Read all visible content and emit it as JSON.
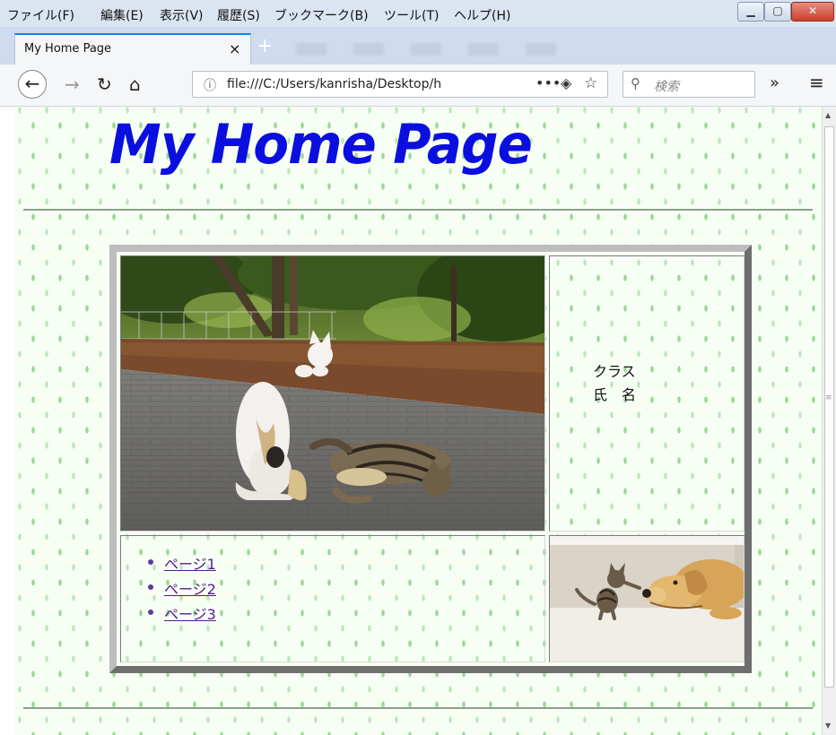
{
  "menubar": {
    "items": [
      "ファイル(F)",
      "編集(E)",
      "表示(V)",
      "履歴(S)",
      "ブックマーク(B)",
      "ツール(T)",
      "ヘルプ(H)"
    ]
  },
  "window": {
    "minimize_icon": "minimize-icon",
    "maximize_icon": "maximize-icon",
    "close_icon": "close-icon"
  },
  "tabs": {
    "active_title": "My Home Page",
    "close_glyph": "×",
    "new_tab_glyph": "+"
  },
  "toolbar": {
    "url": "file:///C:/Users/kanrisha/Desktop/h",
    "search_placeholder": "検索",
    "more_glyph": "•••",
    "overflow_glyph": "»",
    "menu_glyph": "≡"
  },
  "page": {
    "title": "My Home Page",
    "info_lines": [
      "クラス",
      "氏　名"
    ],
    "links": [
      "ページ1",
      "ページ2",
      "ページ3"
    ]
  },
  "colors": {
    "title": "#0a0fe0",
    "link": "#551a8b",
    "page_bg": "#f7fff5",
    "tab_accent": "#0a84ff"
  }
}
